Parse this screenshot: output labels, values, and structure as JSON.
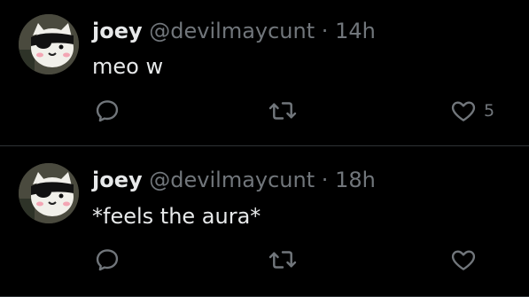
{
  "tweets": [
    {
      "name": "joey",
      "handle": "@devilmaycunt",
      "separator": "·",
      "time": "14h",
      "text": "meo w",
      "like_count": "5",
      "avatar_icon": "cat-avatar-icon"
    },
    {
      "name": "joey",
      "handle": "@devilmaycunt",
      "separator": "·",
      "time": "18h",
      "text": "*feels the aura*",
      "like_count": "",
      "avatar_icon": "cat-avatar-icon"
    }
  ],
  "colors": {
    "background": "#000000",
    "primary_text": "#e7e9ea",
    "secondary_text": "#71767b",
    "divider": "#2f3336"
  },
  "icons": {
    "reply": "reply-icon",
    "retweet": "retweet-icon",
    "like": "heart-icon"
  }
}
